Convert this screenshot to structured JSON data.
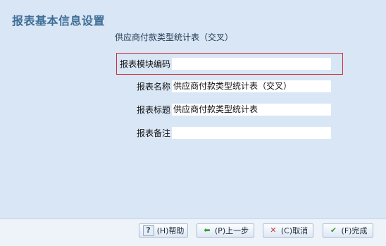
{
  "header": {
    "title": "报表基本信息设置"
  },
  "subtitle": "供应商付款类型统计表（交叉）",
  "fields": [
    {
      "label": "报表模块编码",
      "value": ""
    },
    {
      "label": "报表名称",
      "value": "供应商付款类型统计表（交叉）"
    },
    {
      "label": "报表标题",
      "value": "供应商付款类型统计表"
    },
    {
      "label": "报表备注",
      "value": ""
    }
  ],
  "buttons": {
    "help": "(H)帮助",
    "prev": "(P)上一步",
    "cancel": "(C)取消",
    "finish": "(F)完成"
  },
  "colors": {
    "background": "#d9e6f5",
    "title": "#3f6e96",
    "highlight_border": "#c8323a"
  }
}
